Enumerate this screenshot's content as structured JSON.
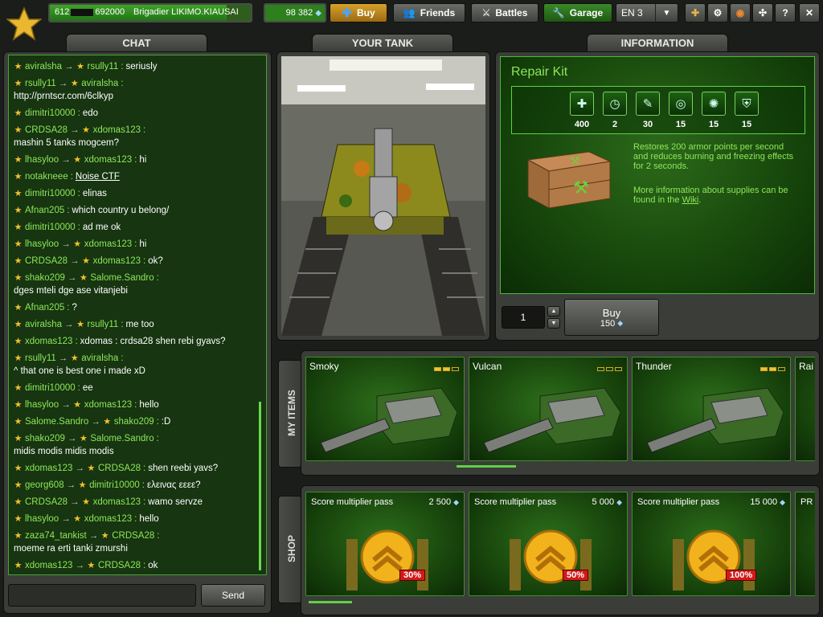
{
  "topbar": {
    "rank_icon": "star-rank-icon",
    "score_prefix": "612",
    "score_suffix": "692000",
    "player": "Brigadier LIKIMO.KIAUSAI",
    "crystals": "98 382",
    "buy": "Buy",
    "friends": "Friends",
    "battles": "Battles",
    "garage": "Garage",
    "language": "EN 3"
  },
  "tabs": {
    "chat": "CHAT",
    "your_tank": "YOUR TANK",
    "information": "INFORMATION"
  },
  "chat": {
    "messages": [
      {
        "from": "aviralsha",
        "to": "rsully11",
        "text": "seriusly"
      },
      {
        "from": "rsully11",
        "to": "aviralsha",
        "text": "http://prntscr.com/6clkyp"
      },
      {
        "from": "dimitri10000",
        "to": "",
        "text": "edo"
      },
      {
        "from": "CRDSA28",
        "to": "xdomas123",
        "text": "mashin 5 tanks mogcem?"
      },
      {
        "from": "lhasyloo",
        "to": "xdomas123",
        "text": "hi"
      },
      {
        "from": "notakneee",
        "to": "",
        "text": "Noise CTF"
      },
      {
        "from": "dimitri10000",
        "to": "",
        "text": "elinas"
      },
      {
        "from": "Afnan205",
        "to": "",
        "text": "which country u belong/"
      },
      {
        "from": "dimitri10000",
        "to": "",
        "text": "ad me ok"
      },
      {
        "from": "lhasyloo",
        "to": "xdomas123",
        "text": "hi"
      },
      {
        "from": "CRDSA28",
        "to": "xdomas123",
        "text": "ok?"
      },
      {
        "from": "shako209",
        "to": "Salome.Sandro",
        "text": "dges mteli dge ase vitanjebi"
      },
      {
        "from": "Afnan205",
        "to": "",
        "text": "?"
      },
      {
        "from": "aviralsha",
        "to": "rsully11",
        "text": "me too"
      },
      {
        "from": "xdomas123",
        "to": "",
        "text": "xdomas : crdsa28 shen rebi gyavs?"
      },
      {
        "from": "rsully11",
        "to": "aviralsha",
        "text": "^ that one is best one i made xD"
      },
      {
        "from": "dimitri10000",
        "to": "",
        "text": "ee"
      },
      {
        "from": "lhasyloo",
        "to": "xdomas123",
        "text": "hello"
      },
      {
        "from": "Salome.Sandro",
        "to": "shako209",
        "text": ":D"
      },
      {
        "from": "shako209",
        "to": "Salome.Sandro",
        "text": "midis modis midis modis"
      },
      {
        "from": "xdomas123",
        "to": "CRDSA28",
        "text": "shen reebi yavs?"
      },
      {
        "from": "georg608",
        "to": "dimitri10000",
        "text": "ελεινας εεεε?"
      },
      {
        "from": "CRDSA28",
        "to": "xdomas123",
        "text": "wamo servze"
      },
      {
        "from": "lhasyloo",
        "to": "xdomas123",
        "text": "hello"
      },
      {
        "from": "zaza74_tankist",
        "to": "CRDSA28",
        "text": "moeme ra erti tanki zmurshi"
      },
      {
        "from": "xdomas123",
        "to": "CRDSA28",
        "text": "ok"
      }
    ],
    "send": "Send"
  },
  "info": {
    "title": "Repair Kit",
    "supplies": [
      {
        "icon": "health-icon",
        "value": "400"
      },
      {
        "icon": "timer-icon",
        "value": "2"
      },
      {
        "icon": "wrench-icon",
        "value": "30"
      },
      {
        "icon": "water-icon",
        "value": "15"
      },
      {
        "icon": "fire-icon",
        "value": "15"
      },
      {
        "icon": "shield-icon",
        "value": "15"
      }
    ],
    "description": "Restores 200 armor points per second and reduces burning and freezing effects for 2 seconds.",
    "more": "More information about supplies can be found in the ",
    "wiki": "Wiki",
    "period": ".",
    "quantity": "1",
    "buy": "Buy",
    "price": "150"
  },
  "my_items": {
    "label": "MY ITEMS",
    "items": [
      {
        "name": "Smoky",
        "level": 2
      },
      {
        "name": "Vulcan",
        "level": 0
      },
      {
        "name": "Thunder",
        "level": 2
      },
      {
        "name": "Rai",
        "level": 0
      }
    ]
  },
  "shop": {
    "label": "SHOP",
    "items": [
      {
        "name": "Score multiplier pass",
        "price": "2 500",
        "badge": "30%"
      },
      {
        "name": "Score multiplier pass",
        "price": "5 000",
        "badge": "50%"
      },
      {
        "name": "Score multiplier pass",
        "price": "15 000",
        "badge": "100%"
      },
      {
        "name": "PR",
        "price": "",
        "badge": ""
      }
    ]
  },
  "colors": {
    "accent": "#8fe65b",
    "panel_green": "#1b5410",
    "gold": "#f2c12e"
  }
}
